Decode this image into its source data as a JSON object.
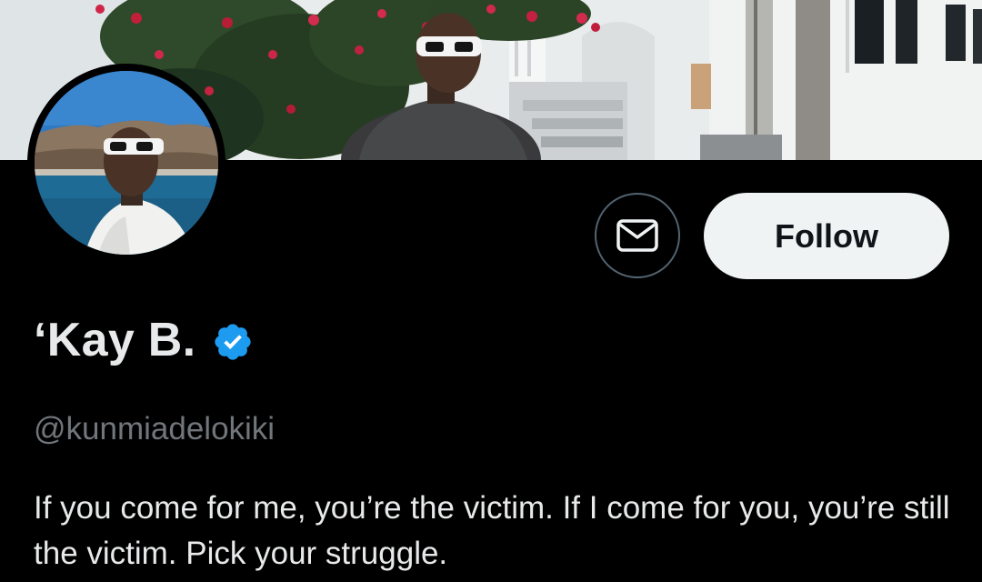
{
  "profile": {
    "display_name": "‘Kay B.",
    "handle": "@kunmiadelokiki",
    "bio": "If you come for me, you’re the victim. If I come for you, you’re still the victim. Pick your struggle.",
    "verified": true
  },
  "actions": {
    "message_icon": "envelope-icon",
    "follow_label": "Follow"
  },
  "colors": {
    "background": "#000000",
    "primary_text": "#e7e9ea",
    "secondary_text": "#71767b",
    "verified_blue": "#1d9bf0",
    "follow_button_bg": "#eff3f4",
    "outline": "#536471"
  }
}
